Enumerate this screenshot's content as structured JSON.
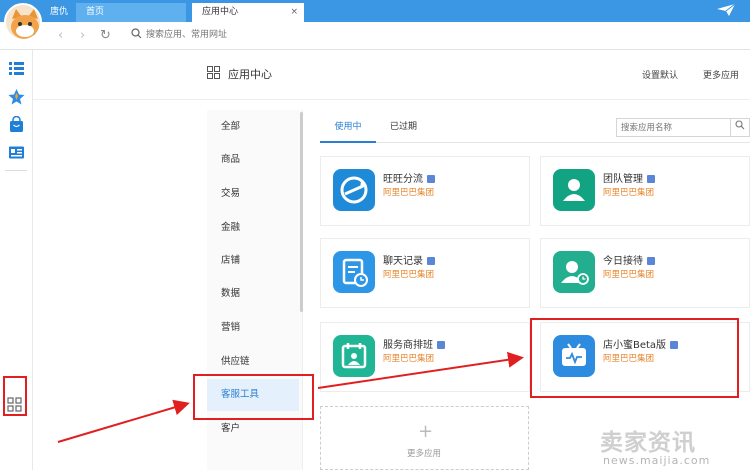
{
  "browser": {
    "tabs": [
      {
        "label": "唐仇"
      },
      {
        "label": "首页"
      },
      {
        "label": "应用中心",
        "close": "×"
      }
    ],
    "address_placeholder": "搜索应用、常用网址",
    "back": "‹",
    "forward": "›",
    "refresh": "↻"
  },
  "header": {
    "title": "应用中心",
    "set_default": "设置默认",
    "more_apps": "更多应用"
  },
  "categories": [
    {
      "label": "全部"
    },
    {
      "label": "商品"
    },
    {
      "label": "交易"
    },
    {
      "label": "金融"
    },
    {
      "label": "店铺"
    },
    {
      "label": "数据"
    },
    {
      "label": "营销"
    },
    {
      "label": "供应链"
    },
    {
      "label": "客服工具",
      "active": true
    },
    {
      "label": "客户"
    }
  ],
  "subtabs": {
    "using": "使用中",
    "expired": "已过期"
  },
  "search_placeholder": "搜索应用名称",
  "apps": [
    {
      "name": "旺旺分流",
      "vendor": "阿里巴巴集团",
      "icon": "diverge-icon",
      "color": "#1f8ad8"
    },
    {
      "name": "团队管理",
      "vendor": "阿里巴巴集团",
      "icon": "team-icon",
      "color": "#12a383"
    },
    {
      "name": "聊天记录",
      "vendor": "阿里巴巴集团",
      "icon": "chat-record-icon",
      "color": "#2e96e6"
    },
    {
      "name": "今日接待",
      "vendor": "阿里巴巴集团",
      "icon": "reception-icon",
      "color": "#22ae8f"
    },
    {
      "name": "服务商排班",
      "vendor": "阿里巴巴集团",
      "icon": "schedule-icon",
      "color": "#1fb595"
    },
    {
      "name": "店小蜜Beta版",
      "vendor": "阿里巴巴集团",
      "icon": "tv-robot-icon",
      "color": "#2d8be0"
    }
  ],
  "add_more": {
    "plus": "+",
    "label": "更多应用"
  },
  "watermark": {
    "cn": "卖家资讯",
    "url": "news.maijia.com"
  },
  "colors": {
    "accent": "#2b7fd1",
    "titlebar": "#3b97e4",
    "vendor": "#e8842a",
    "annotation": "#e02020"
  }
}
